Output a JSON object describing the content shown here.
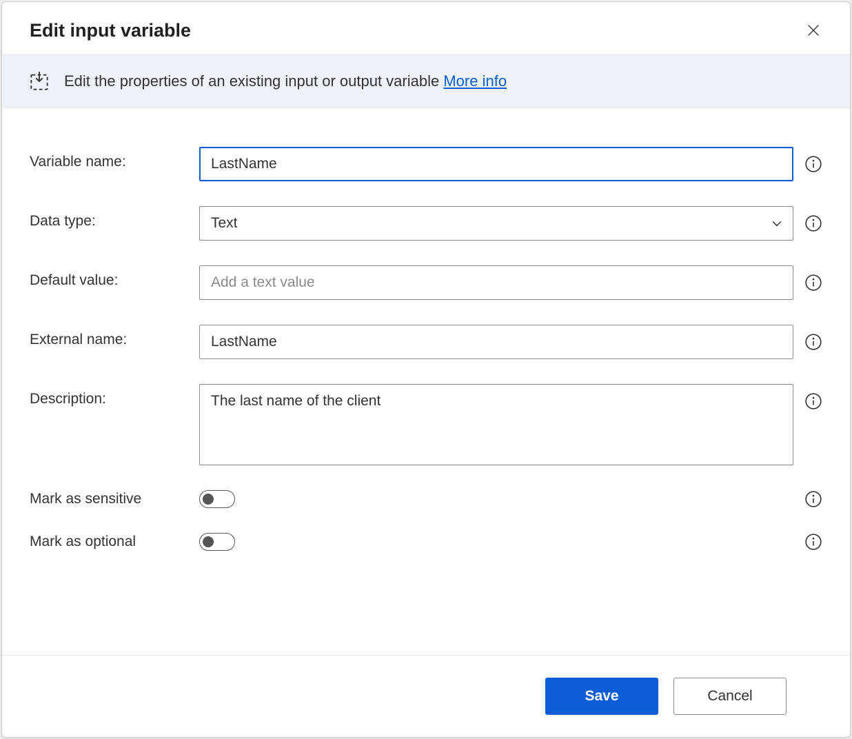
{
  "header": {
    "title": "Edit input variable"
  },
  "banner": {
    "text": "Edit the properties of an existing input or output variable",
    "link": "More info"
  },
  "labels": {
    "variable_name": "Variable name:",
    "data_type": "Data type:",
    "default_value": "Default value:",
    "external_name": "External name:",
    "description": "Description:",
    "mark_sensitive": "Mark as sensitive",
    "mark_optional": "Mark as optional"
  },
  "values": {
    "variable_name": "LastName",
    "data_type": "Text",
    "default_value": "",
    "default_value_placeholder": "Add a text value",
    "external_name": "LastName",
    "description": "The last name of the client",
    "mark_sensitive": false,
    "mark_optional": false
  },
  "footer": {
    "save": "Save",
    "cancel": "Cancel"
  }
}
